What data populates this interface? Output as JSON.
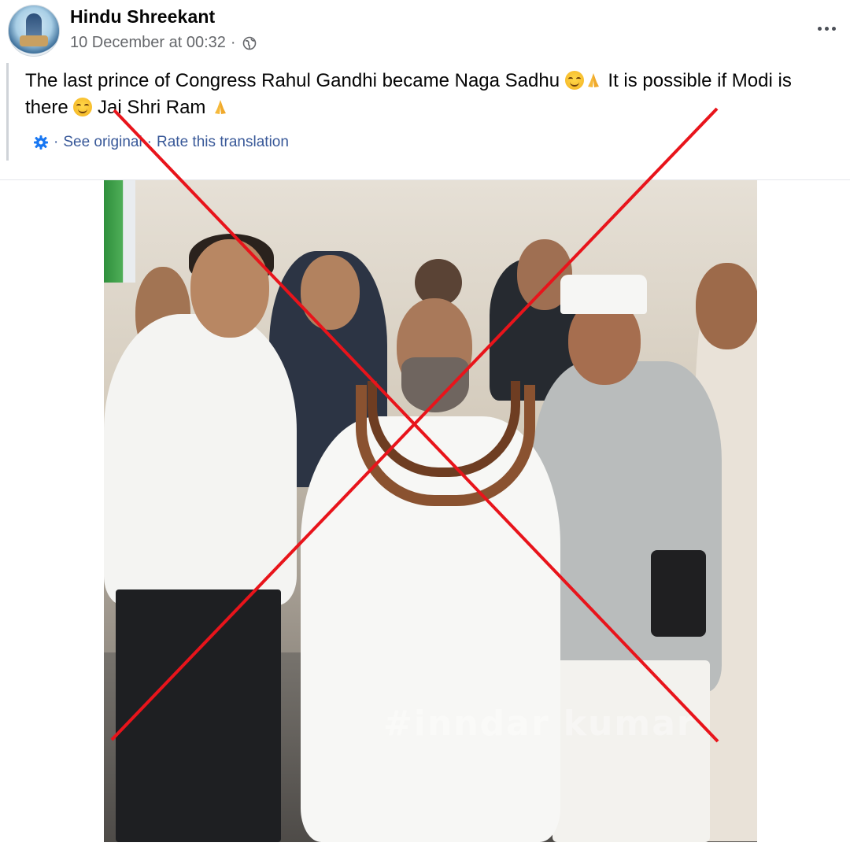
{
  "post": {
    "author_name": "Hindu Shreekant",
    "timestamp": "10 December at 00:32",
    "meta_separator": "·",
    "audience_icon": "globe-icon",
    "more_icon": "more-options-icon"
  },
  "content": {
    "line1_a": "The last prince of Congress Rahul Gandhi became Naga Sadhu ",
    "line1_b": " It is possible if Modi is",
    "line2_a": "there ",
    "line2_b": " Jai Shri Ram ",
    "emoji_1": "smiling-face-emoji",
    "emoji_2": "folded-hands-emoji"
  },
  "translation": {
    "icon": "gear-icon",
    "sep1": "·",
    "see_original": "See original",
    "sep2": "·",
    "rate_translation": "Rate this translation"
  },
  "photo": {
    "watermark": "#inndar kumar",
    "overlay": "red-cross-mark",
    "overlay_color": "#e8141b"
  },
  "colors": {
    "link": "#385898",
    "meta_text": "#65676b",
    "name_text": "#050505"
  }
}
